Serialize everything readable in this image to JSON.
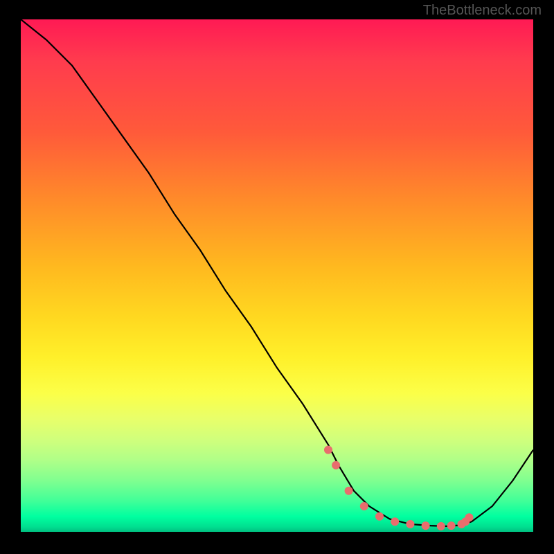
{
  "watermark": "TheBottleneck.com",
  "chart_data": {
    "type": "line",
    "title": "",
    "xlabel": "",
    "ylabel": "",
    "xlim": [
      0,
      100
    ],
    "ylim": [
      0,
      100
    ],
    "series": [
      {
        "name": "curve",
        "x": [
          0,
          5,
          10,
          15,
          20,
          25,
          30,
          35,
          40,
          45,
          50,
          55,
          60,
          62,
          65,
          68,
          72,
          76,
          80,
          83,
          86,
          88,
          92,
          96,
          100
        ],
        "values": [
          100,
          96,
          91,
          84,
          77,
          70,
          62,
          55,
          47,
          40,
          32,
          25,
          17,
          13,
          8,
          5,
          2.5,
          1.5,
          1.2,
          1.1,
          1.3,
          2,
          5,
          10,
          16
        ]
      }
    ],
    "markers": {
      "name": "highlight-points",
      "color": "#e86d6d",
      "x": [
        60,
        61.5,
        64,
        67,
        70,
        73,
        76,
        79,
        82,
        84,
        86,
        86.8,
        87.5
      ],
      "values": [
        16,
        13,
        8,
        5,
        3,
        2,
        1.5,
        1.2,
        1.1,
        1.2,
        1.5,
        2,
        2.8
      ]
    }
  }
}
